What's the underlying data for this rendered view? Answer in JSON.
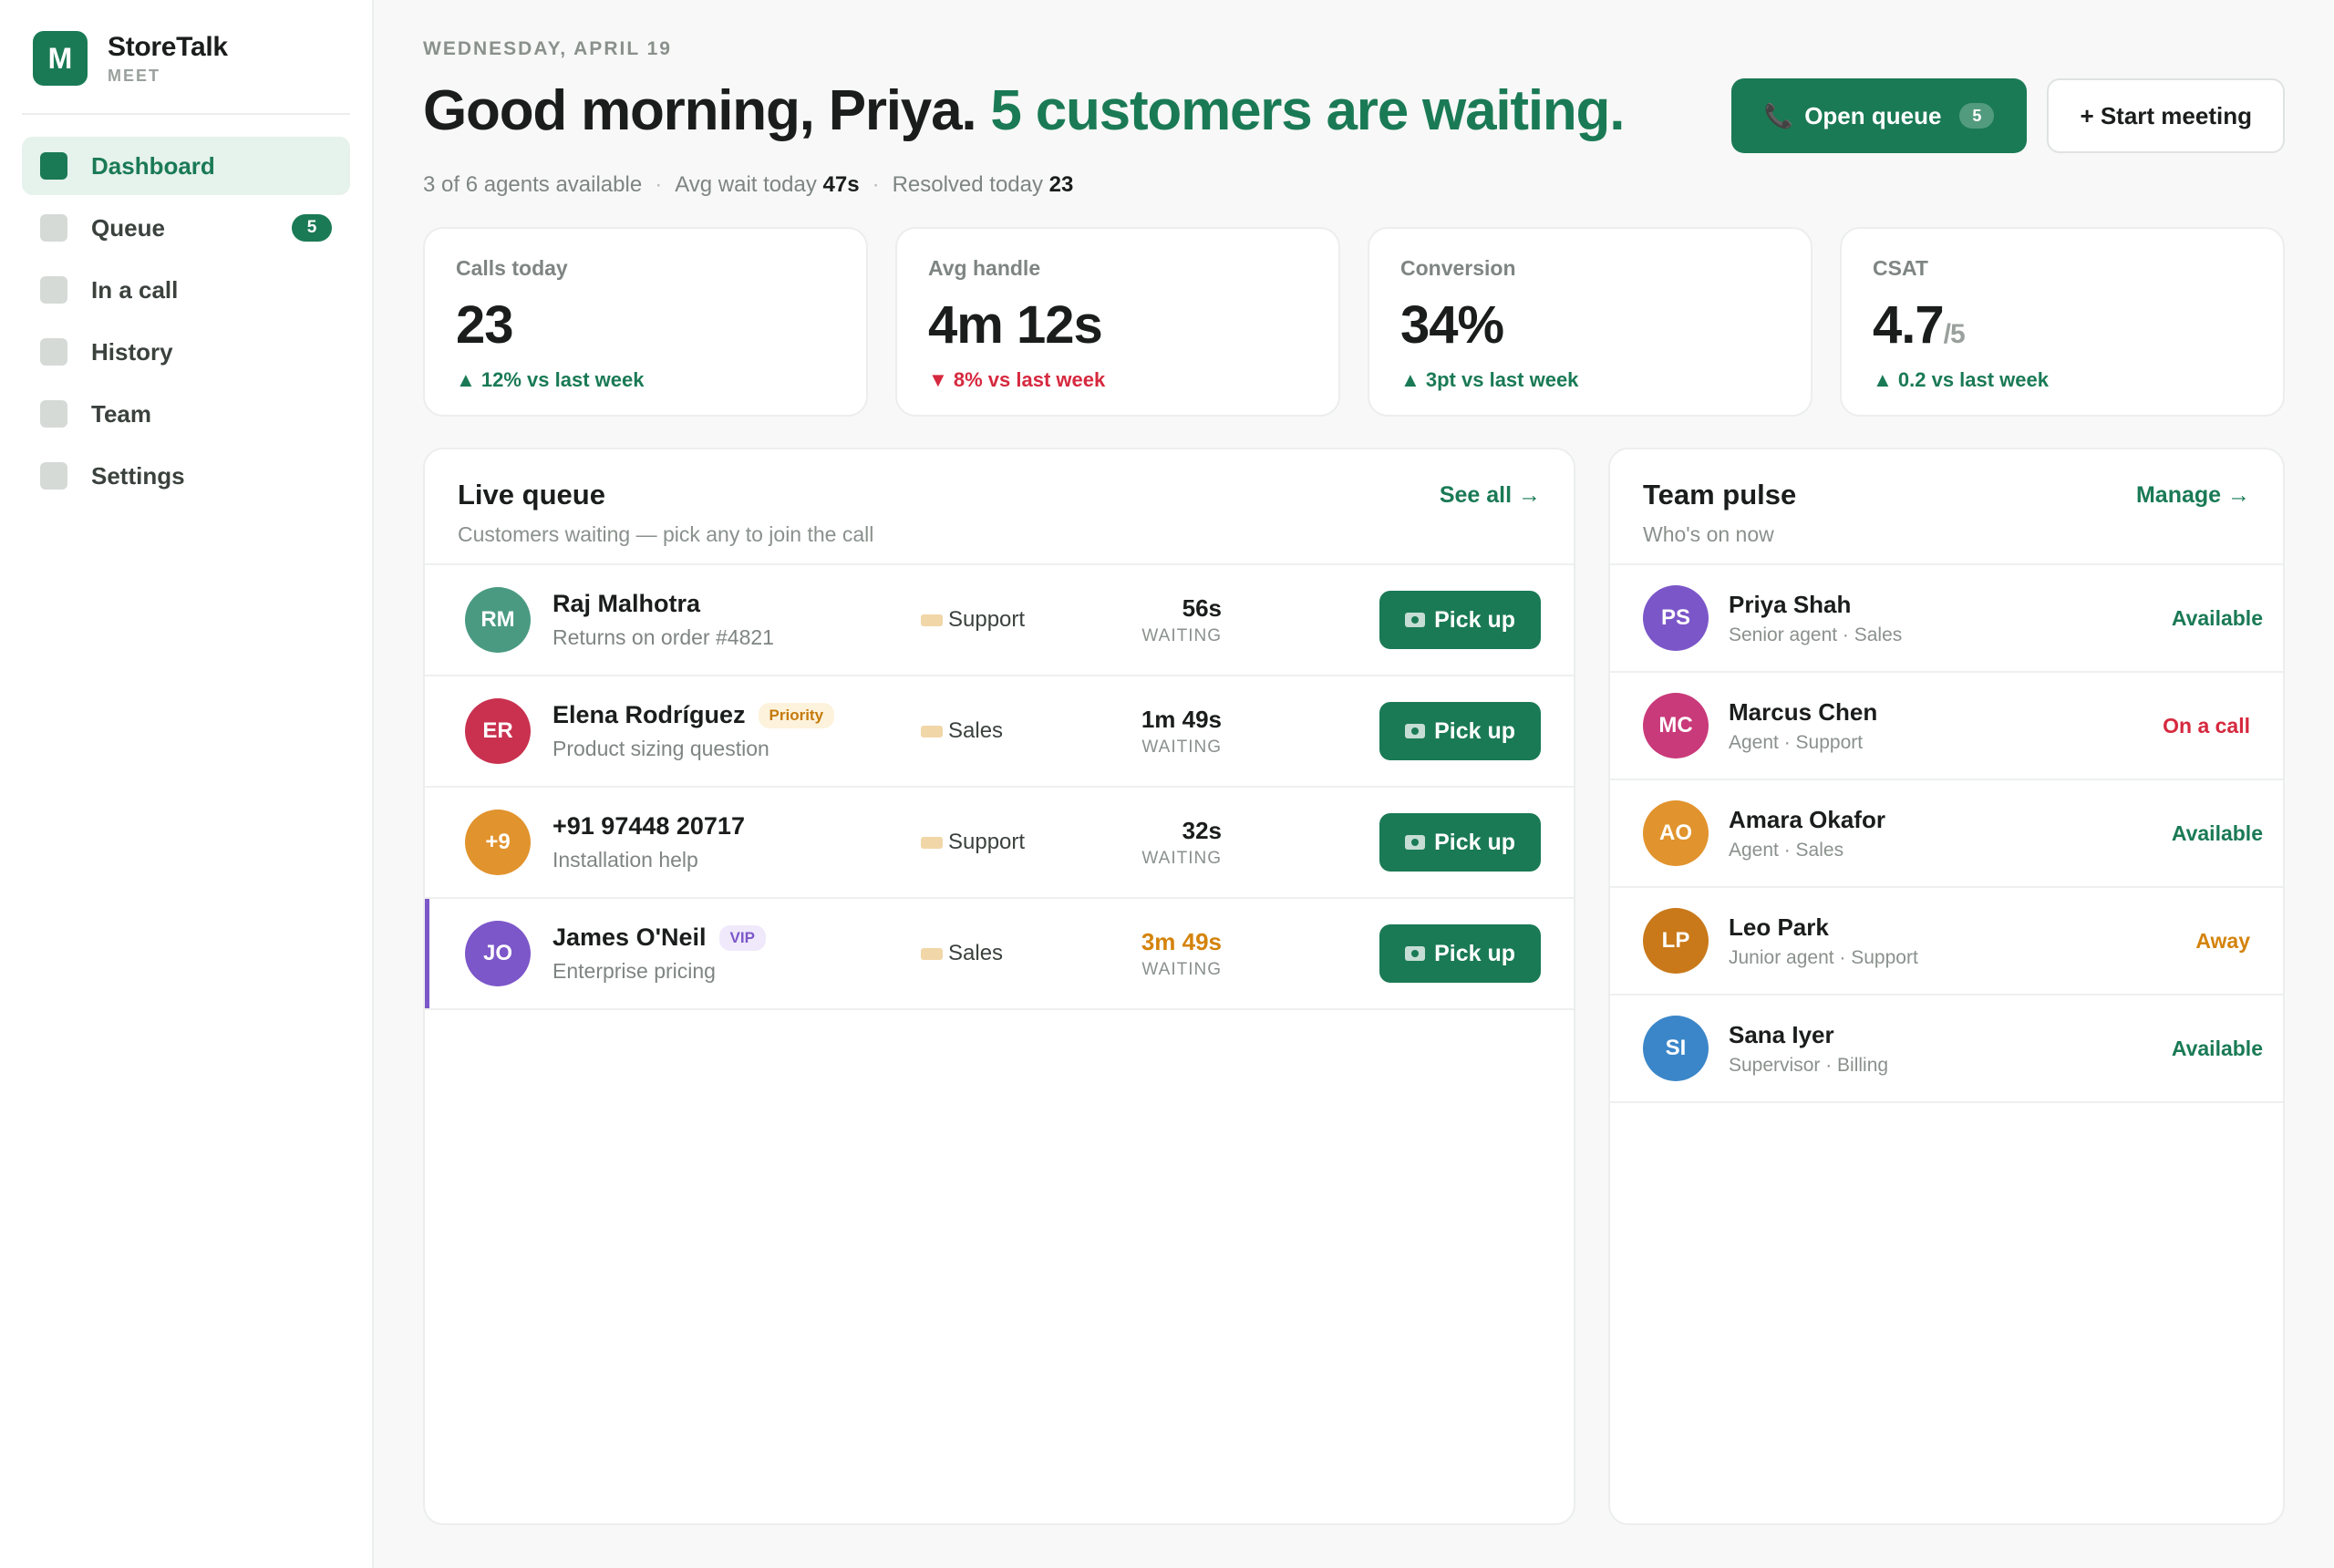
{
  "brand": {
    "logo_letter": "M",
    "name": "StoreTalk",
    "sub": "MEET"
  },
  "nav": [
    {
      "label": "Dashboard",
      "active": true
    },
    {
      "label": "Queue",
      "badge": "5"
    },
    {
      "label": "In a call"
    },
    {
      "label": "History"
    },
    {
      "label": "Team"
    },
    {
      "label": "Settings"
    }
  ],
  "header": {
    "date": "WEDNESDAY, APRIL 19",
    "greeting": "Good morning, Priya.",
    "waiting_text": "5 customers are waiting.",
    "open_queue_label": "Open queue",
    "open_queue_count": "5",
    "start_meeting_label": "+ Start meeting",
    "phone_icon": "📞"
  },
  "stats": {
    "agents": "3 of 6 agents available",
    "avg_wait_label": "Avg wait today",
    "avg_wait_value": "47s",
    "resolved_label": "Resolved today",
    "resolved_value": "23",
    "sep": "·"
  },
  "kpis": [
    {
      "label": "Calls today",
      "value": "23",
      "suffix": "",
      "delta": "▲ 12% vs last week",
      "trend": "up"
    },
    {
      "label": "Avg handle",
      "value": "4m 12s",
      "suffix": "",
      "delta": "▼ 8% vs last week",
      "trend": "down"
    },
    {
      "label": "Conversion",
      "value": "34%",
      "suffix": "",
      "delta": "▲ 3pt vs last week",
      "trend": "up"
    },
    {
      "label": "CSAT",
      "value": "4.7",
      "suffix": "/5",
      "delta": "▲ 0.2 vs last week",
      "trend": "up"
    }
  ],
  "queue": {
    "title": "Live queue",
    "subtitle": "Customers waiting — pick any to join the call",
    "link": "See all →",
    "pickup_label": "Pick up",
    "waiting_label": "WAITING",
    "rows": [
      {
        "initials": "RM",
        "color": "#4a9a82",
        "name": "Raj Malhotra",
        "tag": "",
        "desc": "Returns on order #4821",
        "dept": "Support",
        "wait": "56s",
        "long": false
      },
      {
        "initials": "ER",
        "color": "#c9314f",
        "name": "Elena Rodríguez",
        "tag": "Priority",
        "desc": "Product sizing question",
        "dept": "Sales",
        "wait": "1m 49s",
        "long": false
      },
      {
        "initials": "+9",
        "color": "#e1932d",
        "name": "+91 97448 20717",
        "tag": "",
        "desc": "Installation help",
        "dept": "Support",
        "wait": "32s",
        "long": false
      },
      {
        "initials": "JO",
        "color": "#7c57c9",
        "name": "James O'Neil",
        "tag": "VIP",
        "desc": "Enterprise pricing",
        "dept": "Sales",
        "wait": "3m 49s",
        "long": true
      }
    ]
  },
  "team": {
    "title": "Team pulse",
    "subtitle": "Who's on now",
    "link": "Manage →",
    "rows": [
      {
        "initials": "PS",
        "color": "#7b56c8",
        "name": "Priya Shah",
        "role": "Senior agent · Sales",
        "status": "Available",
        "state": "available"
      },
      {
        "initials": "MC",
        "color": "#c93a7a",
        "name": "Marcus Chen",
        "role": "Agent · Support",
        "status": "On a call",
        "state": "call"
      },
      {
        "initials": "AO",
        "color": "#e1932d",
        "name": "Amara Okafor",
        "role": "Agent · Sales",
        "status": "Available",
        "state": "available"
      },
      {
        "initials": "LP",
        "color": "#c9791a",
        "name": "Leo Park",
        "role": "Junior agent · Support",
        "status": "Away",
        "state": "away"
      },
      {
        "initials": "SI",
        "color": "#3b86c9",
        "name": "Sana Iyer",
        "role": "Supervisor · Billing",
        "status": "Available",
        "state": "available"
      }
    ]
  }
}
